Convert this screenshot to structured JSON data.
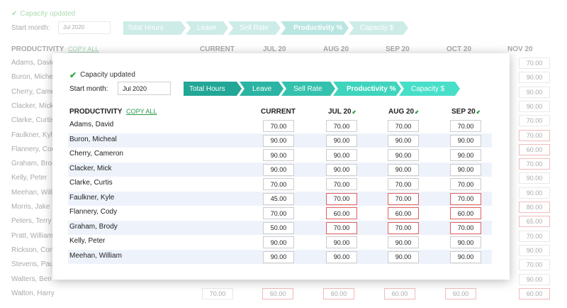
{
  "status": {
    "message": "Capacity updated"
  },
  "start": {
    "label": "Start month:",
    "value": "Jul 2020"
  },
  "steps": [
    "Total Hours",
    "Leave",
    "Sell Rate",
    "Productivity %",
    "Capacity $"
  ],
  "table": {
    "title": "PRODUCTIVITY",
    "copy_all": "COPY ALL",
    "columns": [
      "CURRENT",
      "JUL 20",
      "AUG 20",
      "SEP 20"
    ],
    "rows": [
      {
        "name": "Adams, David",
        "values": [
          "70.00",
          "70.00",
          "70.00",
          "70.00"
        ],
        "error": [
          false,
          false,
          false,
          false
        ]
      },
      {
        "name": "Buron, Micheal",
        "values": [
          "90.00",
          "90.00",
          "90.00",
          "90.00"
        ],
        "error": [
          false,
          false,
          false,
          false
        ]
      },
      {
        "name": "Cherry, Cameron",
        "values": [
          "90.00",
          "90.00",
          "90.00",
          "90.00"
        ],
        "error": [
          false,
          false,
          false,
          false
        ]
      },
      {
        "name": "Clacker, Mick",
        "values": [
          "90.00",
          "90.00",
          "90.00",
          "90.00"
        ],
        "error": [
          false,
          false,
          false,
          false
        ]
      },
      {
        "name": "Clarke, Curtis",
        "values": [
          "70.00",
          "70.00",
          "70.00",
          "70.00"
        ],
        "error": [
          false,
          false,
          false,
          false
        ]
      },
      {
        "name": "Faulkner, Kyle",
        "values": [
          "45.00",
          "70.00",
          "70.00",
          "70.00"
        ],
        "error": [
          false,
          true,
          true,
          true
        ]
      },
      {
        "name": "Flannery, Cody",
        "values": [
          "70.00",
          "60.00",
          "60.00",
          "60.00"
        ],
        "error": [
          false,
          true,
          true,
          true
        ]
      },
      {
        "name": "Graham, Brody",
        "values": [
          "50.00",
          "70.00",
          "70.00",
          "70.00"
        ],
        "error": [
          false,
          true,
          true,
          true
        ]
      },
      {
        "name": "Kelly, Peter",
        "values": [
          "90.00",
          "90.00",
          "90.00",
          "90.00"
        ],
        "error": [
          false,
          false,
          false,
          false
        ]
      },
      {
        "name": "Meehan, William",
        "values": [
          "90.00",
          "90.00",
          "90.00",
          "90.00"
        ],
        "error": [
          false,
          false,
          false,
          false
        ]
      }
    ]
  },
  "background": {
    "status": "Capacity updated",
    "start_label": "Start month:",
    "start_value": "Jul 2020",
    "steps": [
      "Total Hours",
      "Leave",
      "Sell Rate",
      "Productivity %",
      "Capacity $"
    ],
    "title": "PRODUCTIVITY",
    "copy_all": "COPY ALL",
    "columns": [
      "CURRENT",
      "JUL 20",
      "AUG 20",
      "SEP 20",
      "OCT 20",
      "NOV 20"
    ],
    "names": [
      "Adams, David",
      "Buron, Micheal",
      "Cherry, Cameron",
      "Clacker, Mick",
      "Clarke, Curtis",
      "Faulkner, Kyle",
      "Flannery, Cody",
      "Graham, Brody",
      "Kelly, Peter",
      "Meehan, William",
      "Morris, Jake",
      "Peters, Terry",
      "Pratt, William",
      "Rickson, Conor",
      "Stevens, Paul",
      "Walters, Ben",
      "Walton, Harry"
    ],
    "nov_values": [
      "70.00",
      "90.00",
      "90.00",
      "90.00",
      "70.00",
      "70.00",
      "60.00",
      "70.00",
      "90.00",
      "90.00",
      "80.00",
      "65.00",
      "70.00",
      "90.00",
      "70.00",
      "90.00",
      "60.00"
    ],
    "nov_error": [
      false,
      false,
      false,
      false,
      false,
      true,
      true,
      true,
      false,
      false,
      true,
      true,
      false,
      false,
      false,
      false,
      true
    ],
    "last_row": [
      "70.00",
      "60.00",
      "60.00",
      "60.00",
      "60.00",
      "60.00"
    ],
    "last_row_error": [
      false,
      true,
      true,
      true,
      true,
      true
    ]
  },
  "colors": {
    "accent": "#22a696",
    "error": "#e06060",
    "check": "#37a84a",
    "row_alt": "#eef3fb"
  }
}
